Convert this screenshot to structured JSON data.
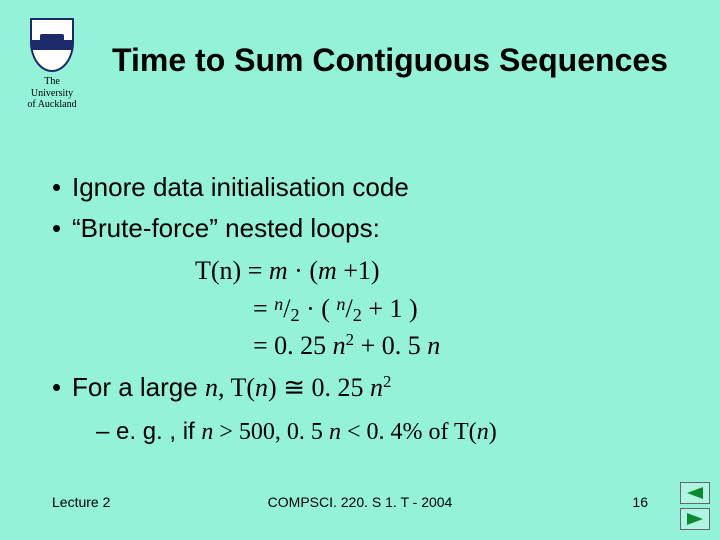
{
  "logo": {
    "line1": "The",
    "line2": "University",
    "line3": "of Auckland"
  },
  "title": "Time to Sum Contiguous Sequences",
  "bullets": {
    "b1": "Ignore data initialisation code",
    "b2": "“Brute-force” nested loops:"
  },
  "math": {
    "lhs": "T(n)",
    "eq": " = ",
    "r1a": "m",
    "r1mid": " · (",
    "r1b": "m",
    "r1c": " +1)",
    "n": "n",
    "slash": "/",
    "two": "2",
    "mid2a": " · ( ",
    "mid2b": " + 1  )",
    "r3a": "0. 25 ",
    "r3n": "n",
    "r3sq": "2",
    "r3b": " + 0. 5 ",
    "r3n2": "n"
  },
  "bullet3": {
    "prefix": "For a large ",
    "n": "n",
    "mid": ", T(",
    "n2": "n",
    "mid2": ") ≅ 0. 25 ",
    "n3": "n",
    "sq": "2"
  },
  "sub": {
    "prefix": "e. g. , if ",
    "n": "n",
    "a": " > 500, 0. 5 ",
    "n2": "n",
    "b": " < 0. 4% of T(",
    "n3": "n",
    "c": ")"
  },
  "footer": {
    "left": "Lecture 2",
    "center": "COMPSCI. 220. S 1. T  - 2004",
    "right": "16"
  }
}
